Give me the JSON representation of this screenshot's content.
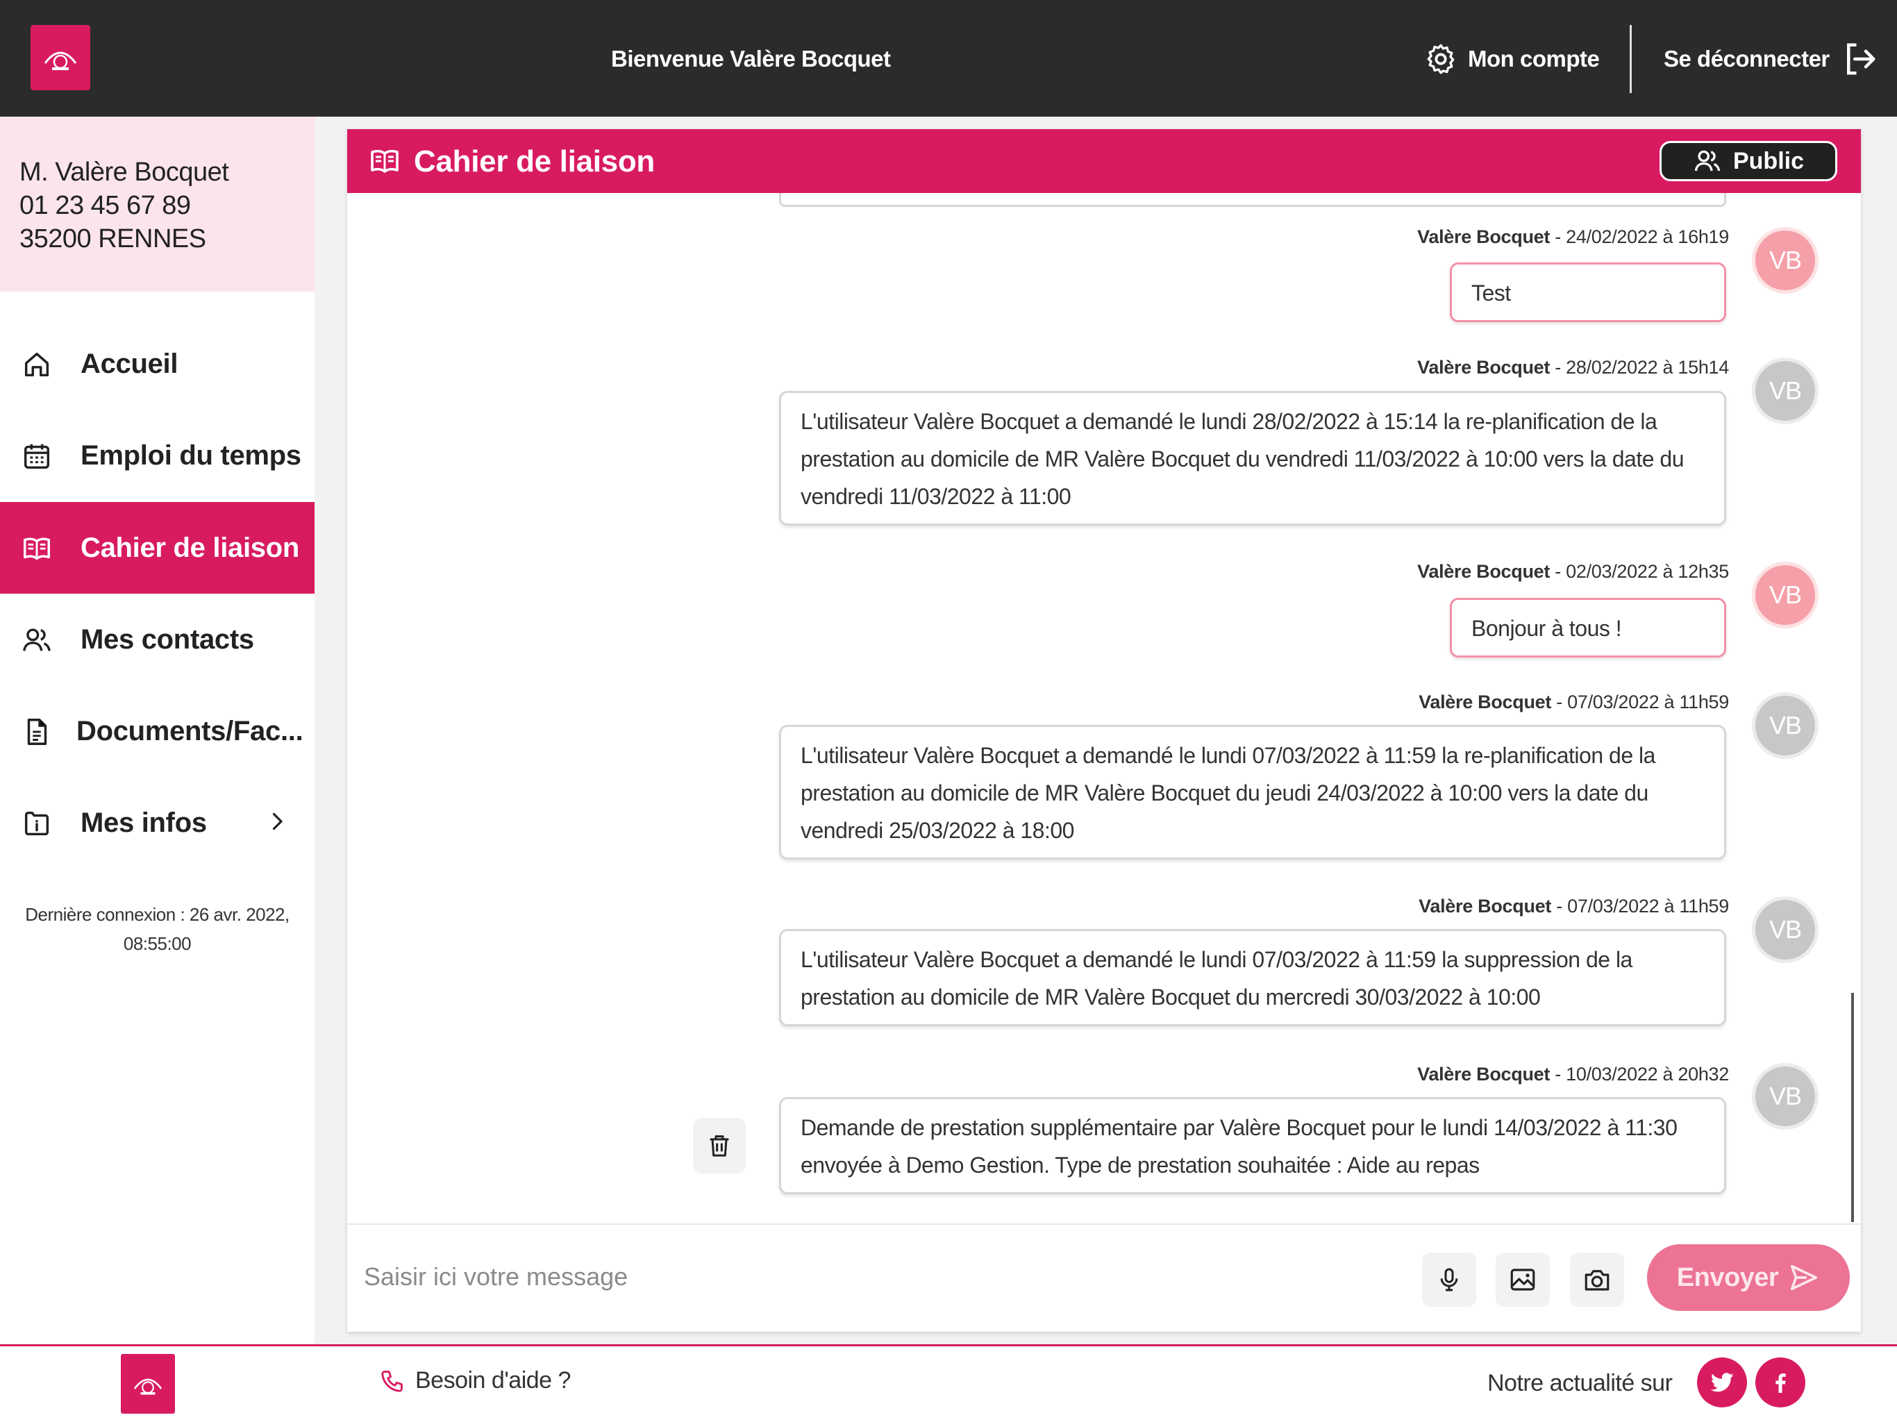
{
  "header": {
    "welcome": "Bienvenue Valère Bocquet",
    "account_label": "Mon compte",
    "logout_label": "Se déconnecter"
  },
  "user": {
    "name": "M. Valère Bocquet",
    "phone": "01 23 45 67 89",
    "city": "35200 RENNES"
  },
  "sidebar": {
    "items": [
      {
        "label": "Accueil",
        "icon": "home-icon"
      },
      {
        "label": "Emploi du temps",
        "icon": "calendar-icon"
      },
      {
        "label": "Cahier de liaison",
        "icon": "book-icon",
        "active": true
      },
      {
        "label": "Mes contacts",
        "icon": "contacts-icon"
      },
      {
        "label": "Documents/Fac...",
        "icon": "document-icon"
      },
      {
        "label": "Mes infos",
        "icon": "info-icon"
      }
    ],
    "last_login_line1": "Dernière connexion : 26 avr. 2022,",
    "last_login_line2": "08:55:00"
  },
  "panel": {
    "title": "Cahier de liaison",
    "visibility_label": "Public"
  },
  "messages": [
    {
      "author": "Valère Bocquet",
      "date": " - 24/02/2022 à 16h19",
      "own": true,
      "initials": "VB",
      "lines": [
        "Test"
      ]
    },
    {
      "author": "Valère Bocquet",
      "date": " - 28/02/2022 à 15h14",
      "own": false,
      "initials": "VB",
      "lines": [
        "L'utilisateur Valère Bocquet a demandé le lundi 28/02/2022 à 15:14 la re-planification de la",
        "prestation au domicile de MR Valère Bocquet du vendredi 11/03/2022 à 10:00 vers la date du",
        "vendredi 11/03/2022 à 11:00"
      ]
    },
    {
      "author": "Valère Bocquet",
      "date": " - 02/03/2022 à 12h35",
      "own": true,
      "initials": "VB",
      "lines": [
        "Bonjour à tous !"
      ]
    },
    {
      "author": "Valère Bocquet",
      "date": " - 07/03/2022 à 11h59",
      "own": false,
      "initials": "VB",
      "lines": [
        "L'utilisateur Valère Bocquet a demandé le lundi 07/03/2022 à 11:59 la re-planification de la",
        "prestation au domicile de MR Valère Bocquet du jeudi 24/03/2022 à 10:00 vers la date du",
        "vendredi 25/03/2022 à 18:00"
      ]
    },
    {
      "author": "Valère Bocquet",
      "date": " - 07/03/2022 à 11h59",
      "own": false,
      "initials": "VB",
      "lines": [
        "L'utilisateur Valère Bocquet a demandé le lundi 07/03/2022 à 11:59 la suppression de la",
        "prestation au domicile de MR Valère Bocquet du mercredi 30/03/2022 à 10:00"
      ]
    },
    {
      "author": "Valère Bocquet",
      "date": " - 10/03/2022 à 20h32",
      "own": false,
      "initials": "VB",
      "lines": [
        "Demande de prestation supplémentaire par Valère Bocquet pour le lundi 14/03/2022 à 11:30",
        "envoyée à Demo Gestion. Type de prestation souhaitée : Aide au repas"
      ]
    }
  ],
  "composer": {
    "placeholder": "Saisir ici votre message",
    "send_label": "Envoyer"
  },
  "footer": {
    "help_label": "Besoin d'aide ?",
    "news_label": "Notre actualité sur"
  },
  "colors": {
    "brand": "#d81b60",
    "topbar": "#2b2b2b",
    "send_button": "#ec7394",
    "user_card_bg": "#fce4ec"
  }
}
